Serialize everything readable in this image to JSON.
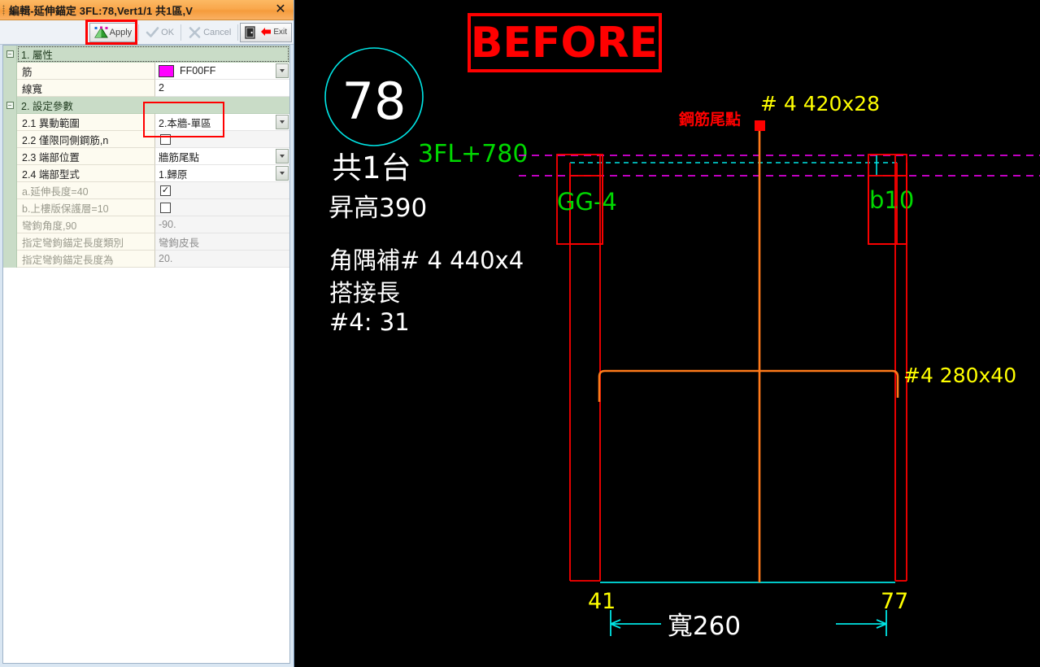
{
  "dialog": {
    "title": "編輯-延伸錨定 3FL:78,Vert1/1 共1區,V",
    "close_label": "✕",
    "toolbar": {
      "apply_label": "Apply",
      "ok_label": "OK",
      "cancel_label": "Cancel",
      "exit_label": "Exit"
    },
    "grid": {
      "categories": [
        {
          "marker": "−",
          "label": "1. 屬性"
        },
        {
          "marker": "−",
          "label": "2. 設定參數"
        }
      ],
      "rows": [
        {
          "name": "筋",
          "value": "FF00FF",
          "type": "color",
          "dropdown": true
        },
        {
          "name": "線寬",
          "value": "2",
          "type": "text",
          "dropdown": false
        },
        {
          "name": "2.1 異動範圍",
          "value": "2.本牆-單區",
          "type": "text",
          "dropdown": true
        },
        {
          "name": "2.2 僅限同側鋼筋,n",
          "value": "",
          "type": "checkbox",
          "checked": false,
          "dropdown": false
        },
        {
          "name": "2.3 端部位置",
          "value": "牆筋尾點",
          "type": "text",
          "dropdown": true
        },
        {
          "name": "2.4 端部型式",
          "value": "1.歸原",
          "type": "text",
          "dropdown": true
        },
        {
          "name": "a.延伸長度=40",
          "value": "",
          "type": "checkbox",
          "checked": true,
          "dropdown": false
        },
        {
          "name": "b.上樓版保護層=10",
          "value": "",
          "type": "checkbox",
          "checked": false,
          "dropdown": false
        },
        {
          "name": "彎鉤角度,90",
          "value": "-90.",
          "type": "text",
          "dropdown": false
        },
        {
          "name": "指定彎鉤錨定長度類別",
          "value": "彎鉤皮長",
          "type": "text",
          "dropdown": false
        },
        {
          "name": "指定彎鉤錨定長度為",
          "value": "20.",
          "type": "text",
          "dropdown": false
        }
      ]
    }
  },
  "cad": {
    "banner": "BEFORE",
    "circle_number": "78",
    "count_label": "共1台",
    "rise_label": "昇高390",
    "corner_bar": "角隅補# 4  440x4",
    "lap_label": "搭接長",
    "lap_value": "#4:  31",
    "level_label": "3FL+780",
    "left_member": "GG-4",
    "right_member": "b10",
    "top_bar": "# 4  420x28",
    "end_point_label": "鋼筋尾點",
    "bottom_bar": "#4  280x40",
    "dim_left": "41",
    "dim_right": "77",
    "width_label": "寬260",
    "colors": {
      "banner_red": "#ff0000",
      "cyan": "#00e5e5",
      "green": "#00ff00",
      "yellow": "#ffff00",
      "magenta": "#ff00ff",
      "orange": "#ff7a1a",
      "wall_red": "#ff0000",
      "white": "#ffffff"
    }
  }
}
